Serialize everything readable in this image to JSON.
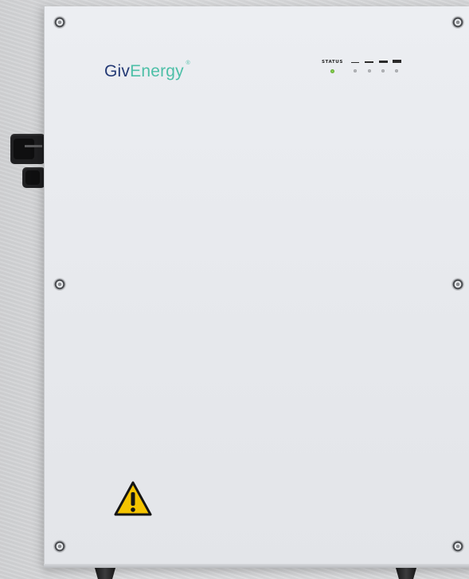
{
  "device": {
    "brand_part1": "Giv",
    "brand_part2": "Energy",
    "brand_mark": "®",
    "status_label": "STATUS",
    "status_led_color": "#4a9a22",
    "panel_color": "#e8eaee",
    "brand_colors": {
      "giv": "#243a75",
      "energy": "#4dbfa7"
    },
    "icons": [
      "warning-triangle-icon",
      "screw-icon",
      "status-led-icon",
      "cable-connector-icon"
    ]
  }
}
